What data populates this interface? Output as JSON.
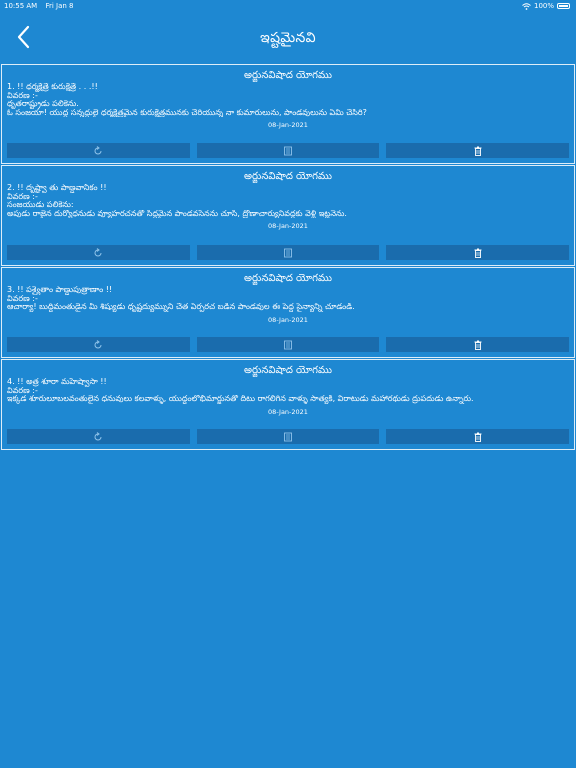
{
  "status": {
    "time": "10:55 AM",
    "date": "Fri Jan 8",
    "battery": "100%"
  },
  "nav": {
    "title": "ఇష్టమైనవి",
    "back_icon": "chevron-left-icon"
  },
  "cards": [
    {
      "title": "అర్జునవిషాద యోగము",
      "verse": "1. !! ధర్మక్షేత్రే కురుక్షేత్రే . . .!!",
      "meaning_label": "వివరణ  :-",
      "line1": "ధృతరాష్ట్రుడు పలికెను.",
      "line2": "ఓ సంజయా! యుద్ధ సన్నద్ధులై ధర్మక్షేత్రమైన కురుక్షేత్రమునకు చేరియున్న నా కుమారులును, పాండవులును ఏమి చేసిరి?",
      "date": "08-Jan-2021"
    },
    {
      "title": "అర్జునవిషాద యోగము",
      "verse": "2. !! దృష్ట్వా తు పాణ్డవానీకం  !!",
      "meaning_label": "వివరణ  :-",
      "line1": "సంజయుడు పలికెను:",
      "line2": "అపుడు రాజైన దుర్యోధనుడు వ్యూహరచనతో సిద్ధమైన పాండవసేనను చూసి, ద్రోణాచార్యునివద్దకు వెళ్లి ఇట్లనెను.",
      "date": "08-Jan-2021"
    },
    {
      "title": "అర్జునవిషాద యోగము",
      "verse": "3. !! పశ్యైతాం పాణ్డుపుత్రాణాం  !!",
      "meaning_label": "వివరణ  :-",
      "line1": "",
      "line2": "ఆచార్యా! బుద్ధిమంతుడైన మీ శిష్యుడు ధృష్టద్యుమ్నుని చేత ఏర్పరచ బడిన పాండవుల ఈ పెద్ద సైన్యాన్ని చూడండి.",
      "date": "08-Jan-2021"
    },
    {
      "title": "అర్జునవిషాద యోగము",
      "verse": "4. !! అత్ర శూరా మహేష్వాసా  !!",
      "meaning_label": "వివరణ  :-",
      "line1": "",
      "line2": "ఇక్కడ శూరులూబలవంతులైన ధనువులు కలవాళ్ళు, యుద్ధంలోభీమార్జునతో దీటు రాగలిగిన వాళ్ళు సాత్యకీ, విరాటుడు మహారథుడు ద్రుపదుడు ఉన్నారు.",
      "date": "08-Jan-2021"
    }
  ],
  "actions": {
    "icons": [
      "share-icon",
      "notes-icon",
      "trash-icon"
    ]
  },
  "colors": {
    "background": "#1e88d2",
    "button": "#1a6cad",
    "text": "#ffffff"
  }
}
